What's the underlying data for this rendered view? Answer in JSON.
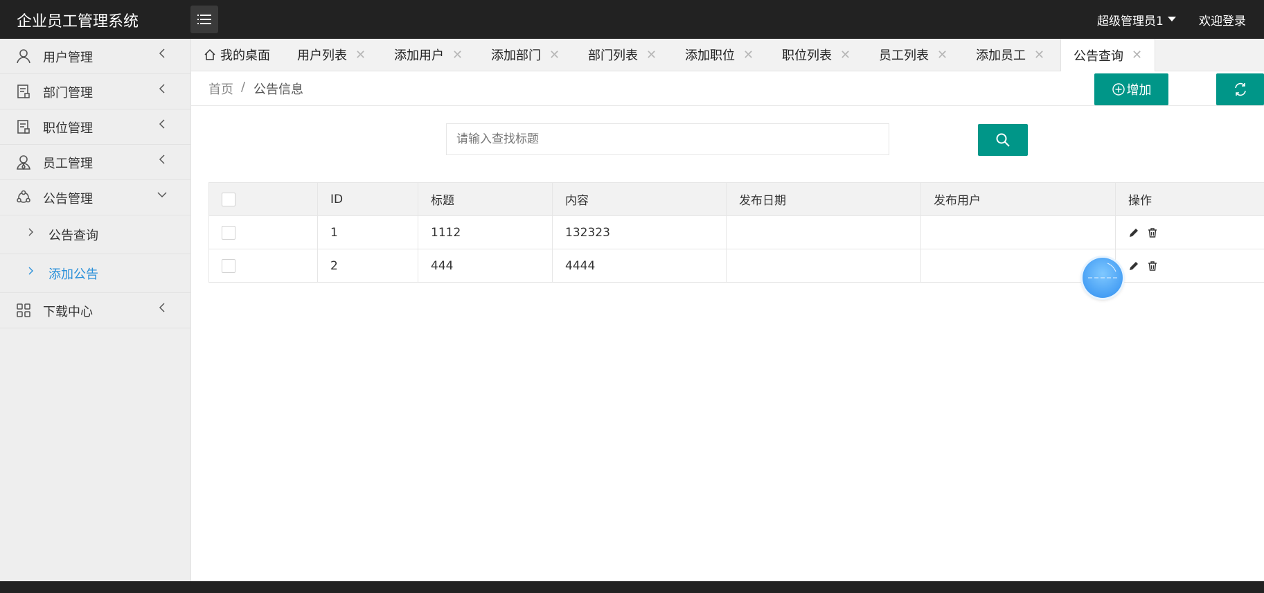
{
  "app": {
    "title": "企业员工管理系统"
  },
  "header": {
    "user_name": "超级管理员1",
    "logout_label": "欢迎登录"
  },
  "sidebar": {
    "items": [
      {
        "label": "用户管理",
        "icon": "user-icon"
      },
      {
        "label": "部门管理",
        "icon": "document-icon"
      },
      {
        "label": "职位管理",
        "icon": "document-icon"
      },
      {
        "label": "员工管理",
        "icon": "employee-icon"
      },
      {
        "label": "公告管理",
        "icon": "share-icon",
        "expanded": true,
        "children": [
          {
            "label": "公告查询"
          },
          {
            "label": "添加公告",
            "active": true
          }
        ]
      },
      {
        "label": "下载中心",
        "icon": "grid-icon"
      }
    ]
  },
  "tabs": [
    {
      "label": "我的桌面",
      "icon": "home-icon"
    },
    {
      "label": "用户列表"
    },
    {
      "label": "添加用户"
    },
    {
      "label": "添加部门"
    },
    {
      "label": "部门列表"
    },
    {
      "label": "添加职位"
    },
    {
      "label": "职位列表"
    },
    {
      "label": "员工列表"
    },
    {
      "label": "添加员工"
    },
    {
      "label": "公告查询",
      "active": true
    }
  ],
  "breadcrumb": {
    "home": "首页",
    "separator": "/",
    "current": "公告信息"
  },
  "actions": {
    "add_label": "增加"
  },
  "search": {
    "placeholder": "请输入查找标题",
    "value": ""
  },
  "table": {
    "columns": [
      "ID",
      "标题",
      "内容",
      "发布日期",
      "发布用户",
      "操作"
    ],
    "rows": [
      {
        "id": "1",
        "title": "1112",
        "content": "132323",
        "date": "",
        "user": ""
      },
      {
        "id": "2",
        "title": "444",
        "content": "4444",
        "date": "",
        "user": ""
      }
    ]
  },
  "colors": {
    "header_bg": "#222222",
    "accent": "#009688",
    "active_link": "#2a90d9",
    "sidebar_bg": "#eeeeee"
  }
}
